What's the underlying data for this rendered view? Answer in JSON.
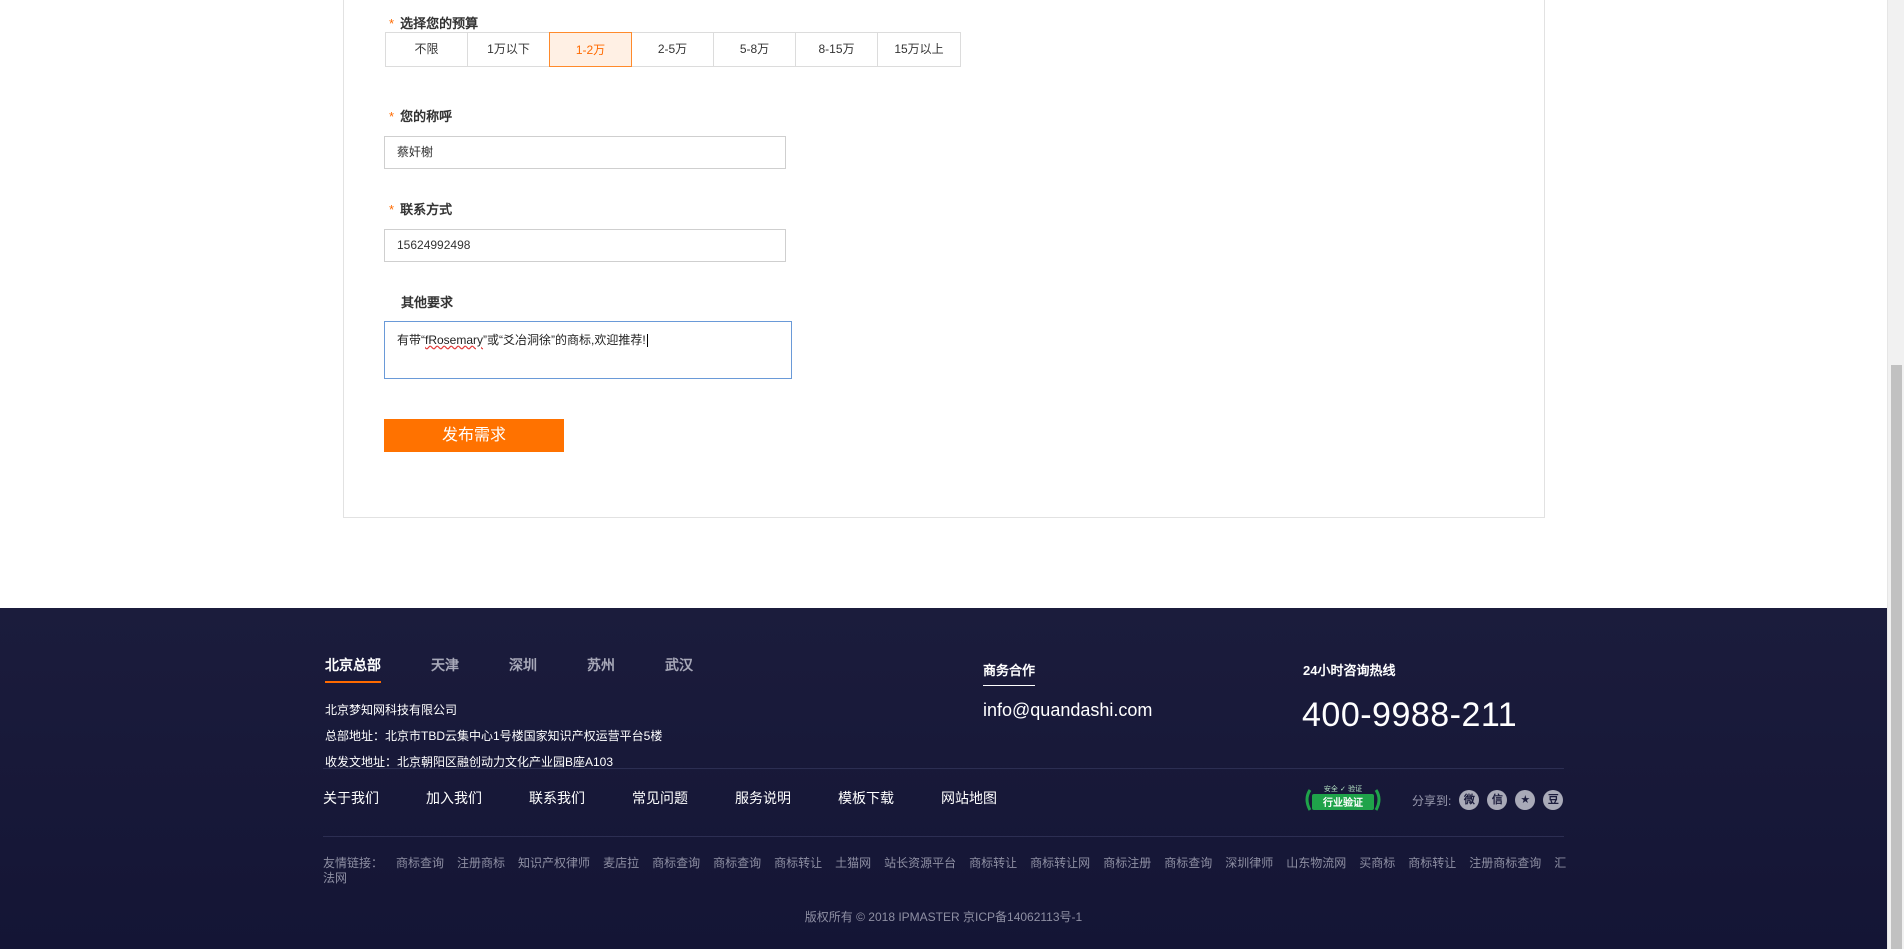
{
  "form": {
    "budget_label": "选择您的预算",
    "budget_options": [
      "不限",
      "1万以下",
      "1-2万",
      "2-5万",
      "5-8万",
      "8-15万",
      "15万以上"
    ],
    "budget_selected": "1-2万",
    "name_label": "您的称呼",
    "name_value": "蔡奸榭",
    "contact_label": "联系方式",
    "contact_value": "15624992498",
    "other_label": "其他要求",
    "other_value_pre": "有带“",
    "other_value_mark": "fRosemary",
    "other_value_post": "”或“爻冶洞徐”的商标,欢迎推荐!",
    "required_mark": "*",
    "submit_label": "发布需求"
  },
  "footer": {
    "cities": [
      "北京总部",
      "天津",
      "深圳",
      "苏州",
      "武汉"
    ],
    "active_city": "北京总部",
    "company": "北京梦知网科技有限公司",
    "hq_address": "总部地址：北京市TBD云集中心1号楼国家知识产权运营平台5楼",
    "mail_address": "收发文地址：北京朝阳区融创动力文化产业园B座A103",
    "biz_title": "商务合作",
    "biz_email": "info@quandashi.com",
    "hotline_title": "24小时咨询热线",
    "hotline": "400-9988-211",
    "nav": [
      "关于我们",
      "加入我们",
      "联系我们",
      "常见问题",
      "服务说明",
      "模板下载",
      "网站地图"
    ],
    "badge_top": "安全 ✓ 验证",
    "badge_text": "行业验证",
    "share_label": "分享到:",
    "share_icons": [
      "weibo-icon",
      "wechat-icon",
      "star-icon",
      "douban-icon"
    ],
    "share_glyphs": [
      "微",
      "信",
      "★",
      "豆"
    ],
    "friend_label": "友情链接：",
    "friend_links": [
      "商标查询",
      "注册商标",
      "知识产权律师",
      "麦店拉",
      "商标查询",
      "商标查询",
      "商标转让",
      "土猫网",
      "站长资源平台",
      "商标转让",
      "商标转让网",
      "商标注册",
      "商标查询",
      "深圳律师",
      "山东物流网",
      "买商标",
      "商标转让",
      "注册商标查询",
      "汇法网"
    ],
    "copyright": "版权所有 © 2018 IPMASTER 京ICP备14062113号-1"
  },
  "colors": {
    "accent": "#ff7200",
    "footer_bg": "#1b1c3c"
  }
}
